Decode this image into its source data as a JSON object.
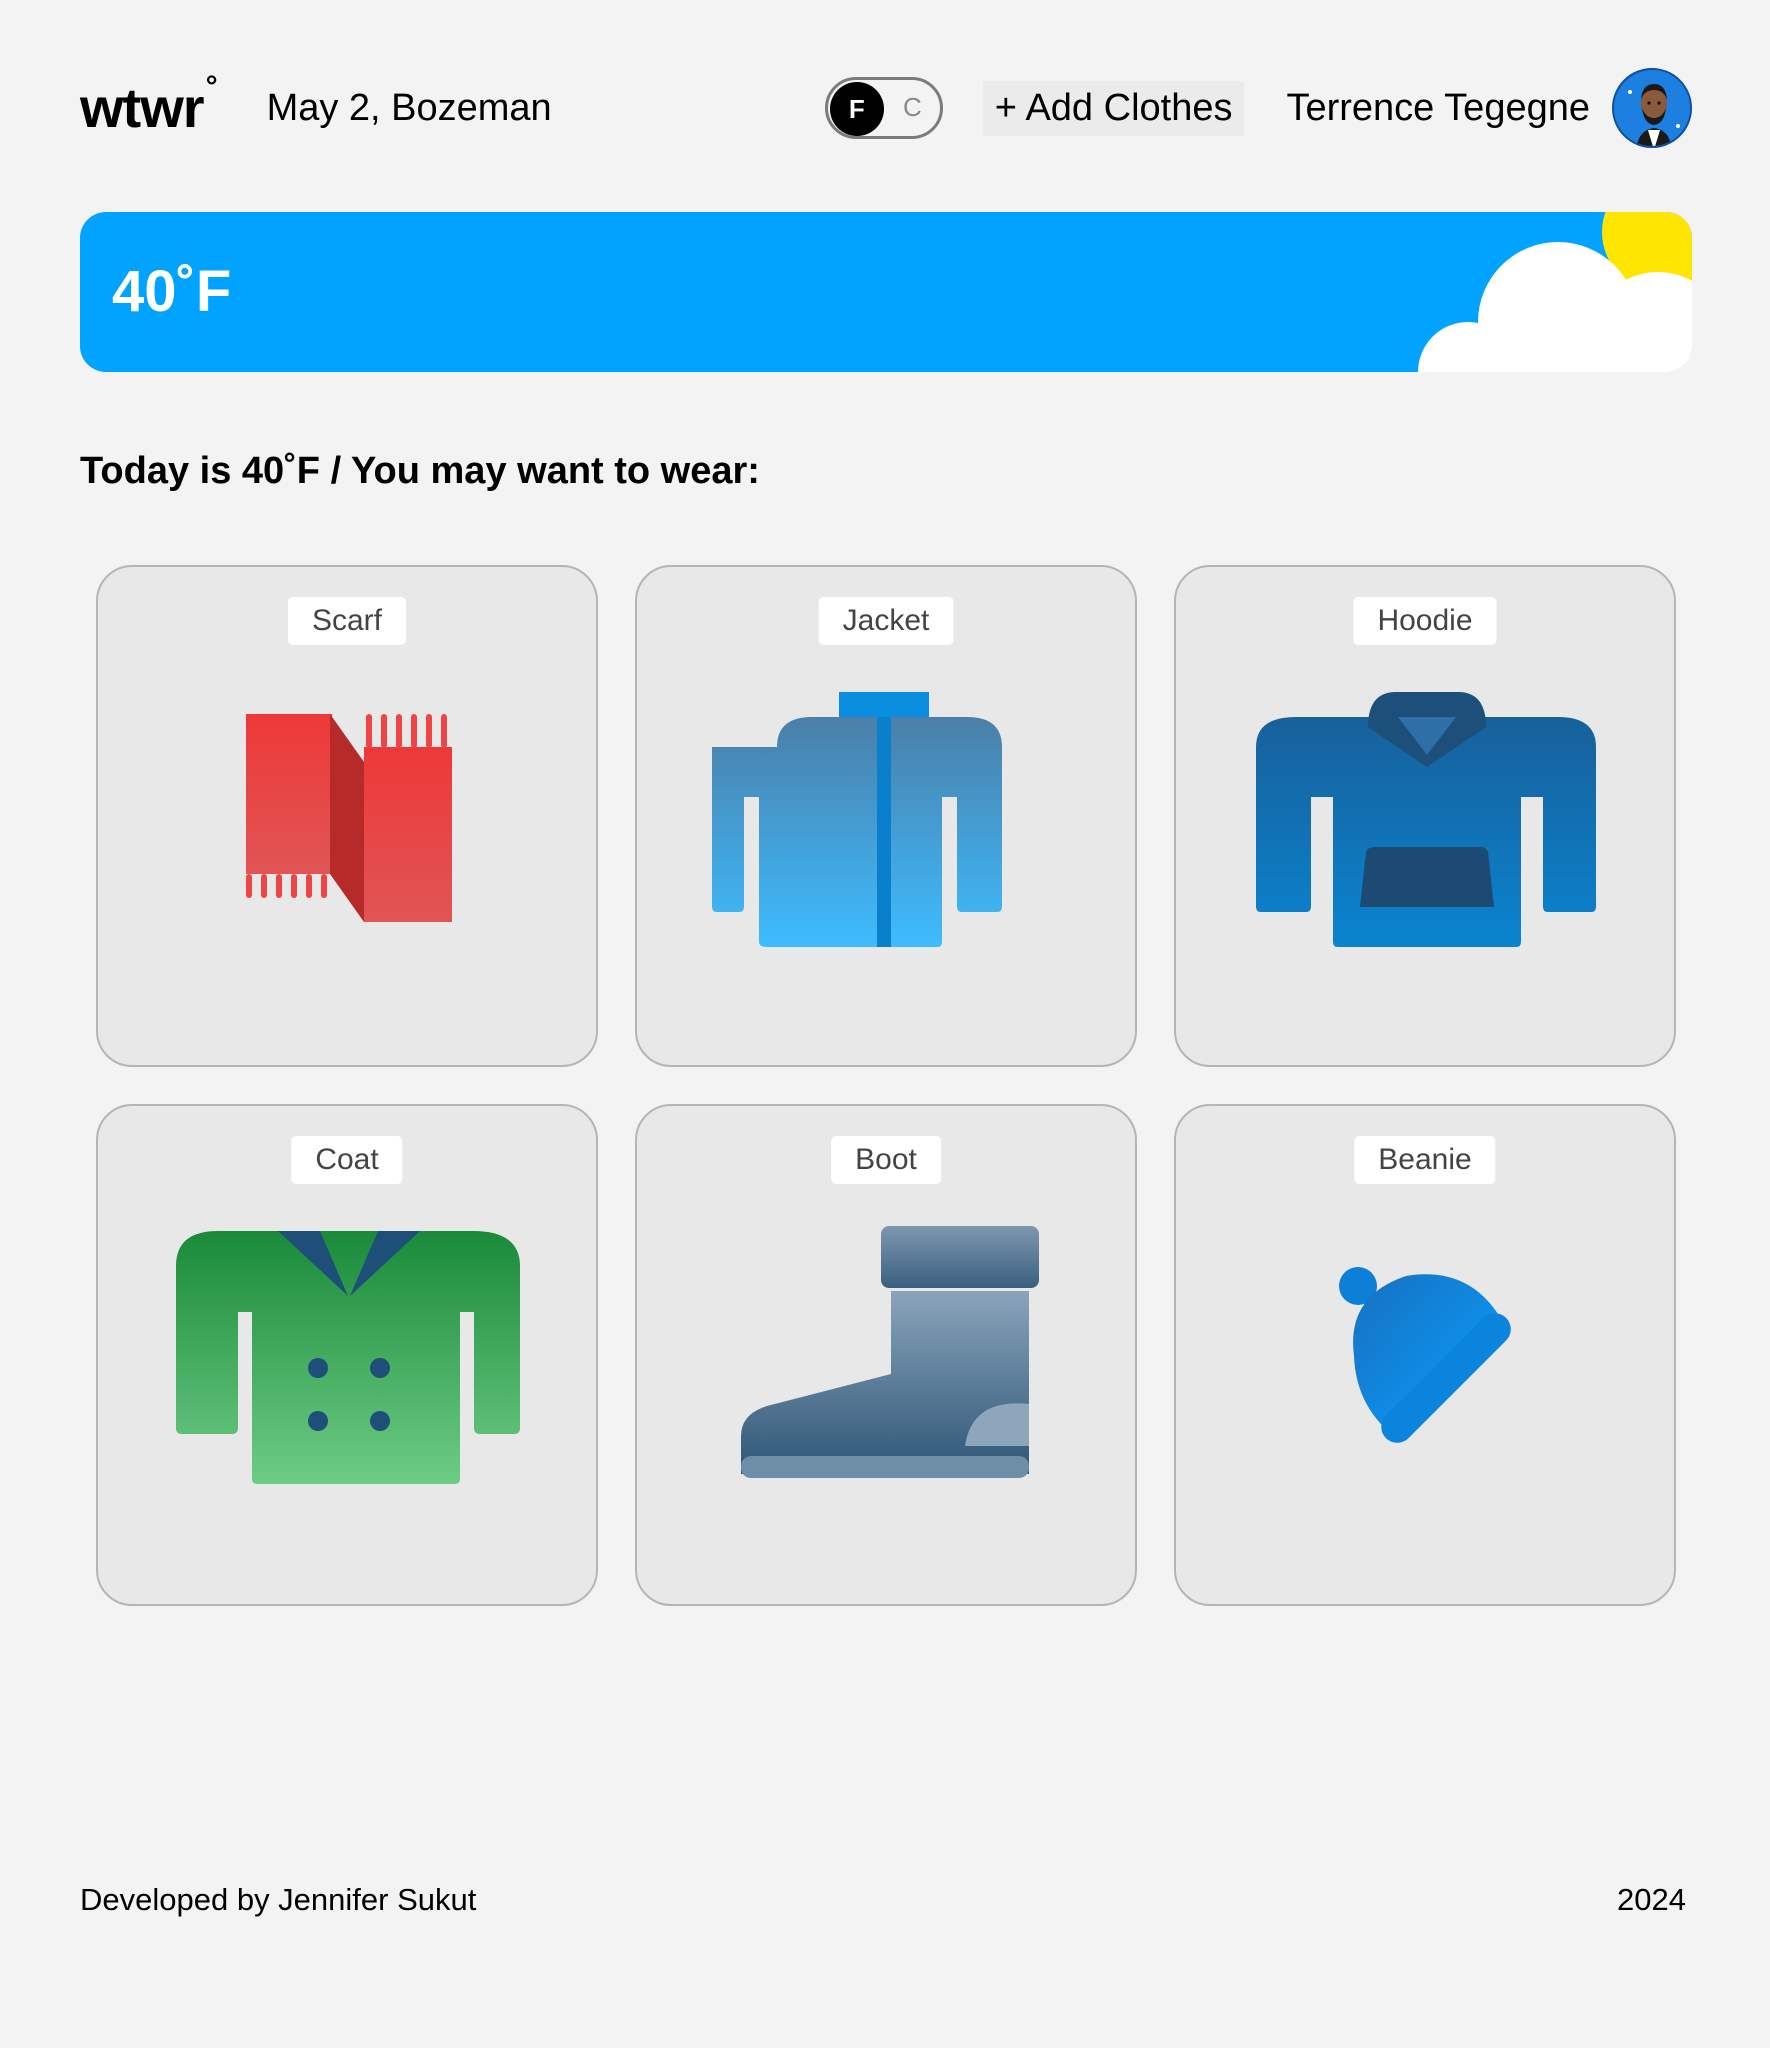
{
  "header": {
    "logo": "wtwr",
    "logo_degree": "°",
    "date_location": "May 2, Bozeman",
    "toggle": {
      "active": "F",
      "inactive": "C"
    },
    "add_clothes_label": "+ Add Clothes",
    "user_name": "Terrence Tegegne"
  },
  "weather": {
    "temperature": "40˚F",
    "condition_icons": [
      "cloud-icon",
      "sun-icon"
    ]
  },
  "recommendation": "Today is 40˚F / You may want to wear:",
  "items": [
    {
      "label": "Scarf",
      "icon": "scarf-icon"
    },
    {
      "label": "Jacket",
      "icon": "jacket-icon"
    },
    {
      "label": "Hoodie",
      "icon": "hoodie-icon"
    },
    {
      "label": "Coat",
      "icon": "coat-icon"
    },
    {
      "label": "Boot",
      "icon": "boot-icon"
    },
    {
      "label": "Beanie",
      "icon": "beanie-icon"
    }
  ],
  "footer": {
    "credit": "Developed by Jennifer Sukut",
    "year": "2024"
  },
  "colors": {
    "background": "#f3f3f3",
    "banner": "#00a3ff",
    "sun": "#ffe600"
  }
}
